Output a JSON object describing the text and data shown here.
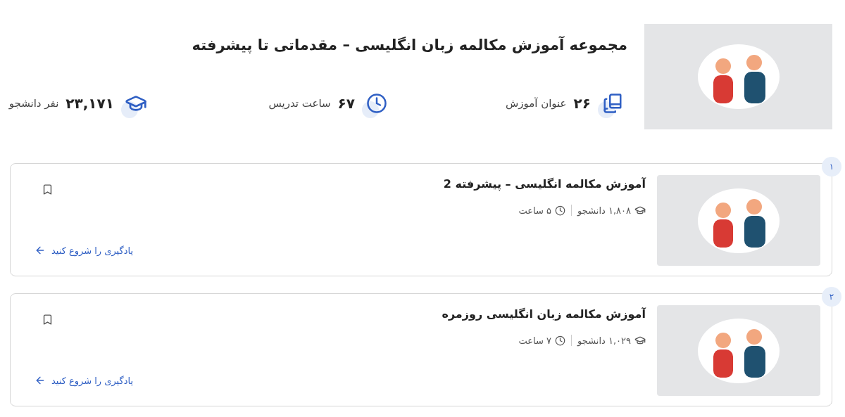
{
  "header": {
    "title": "مجموعه آموزش مکالمه زبان انگلیسی – مقدماتی تا پیشرفته",
    "stats": [
      {
        "kind": "courses",
        "value": "۲۶",
        "label": "عنوان آموزش"
      },
      {
        "kind": "hours",
        "value": "۶۷",
        "label": "ساعت تدریس"
      },
      {
        "kind": "students",
        "value": "۲۳,۱۷۱",
        "label": "نفر دانشجو"
      }
    ]
  },
  "courses": [
    {
      "number": "۱",
      "title": "آموزش مکالمه انگلیسی – پیشرفته 2",
      "students": "۱,۸۰۸ دانشجو",
      "duration": "۵ ساعت",
      "link": "یادگیری را شروع کنید"
    },
    {
      "number": "۲",
      "title": "آموزش مکالمه زبان انگلیسی روزمره",
      "students": "۱,۰۲۹ دانشجو",
      "duration": "۷ ساعت",
      "link": "یادگیری را شروع کنید"
    }
  ]
}
